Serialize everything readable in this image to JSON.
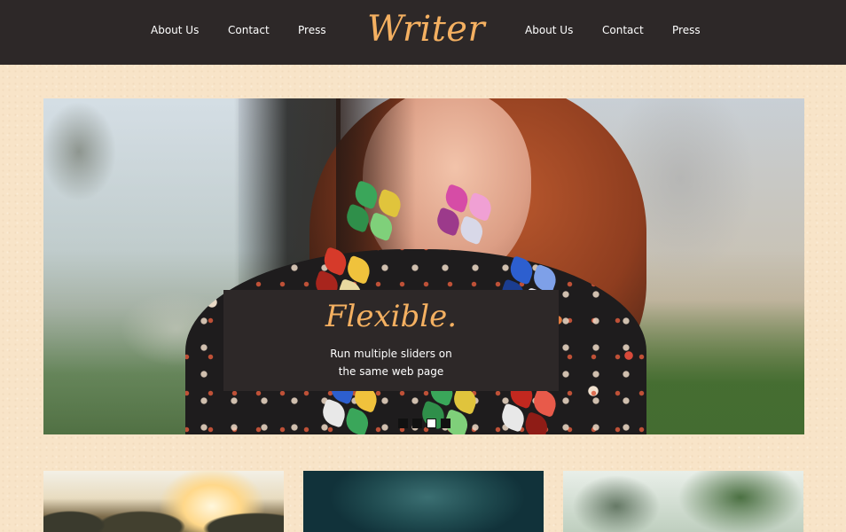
{
  "header": {
    "logo": "Writer",
    "nav_left": [
      "About Us",
      "Contact",
      "Press"
    ],
    "nav_right": [
      "About Us",
      "Contact",
      "Press"
    ]
  },
  "slider": {
    "caption_title": "Flexible.",
    "caption_lines": [
      "Run multiple sliders on",
      "the same web page"
    ],
    "dots": {
      "count": 4,
      "active_index": 2
    }
  },
  "thumbnails": [
    "sunset-field",
    "dark-teal-blur",
    "trees"
  ],
  "colors": {
    "header_bg": "#2d2828",
    "accent": "#f4b061",
    "page_bg": "#f8e4c8"
  }
}
